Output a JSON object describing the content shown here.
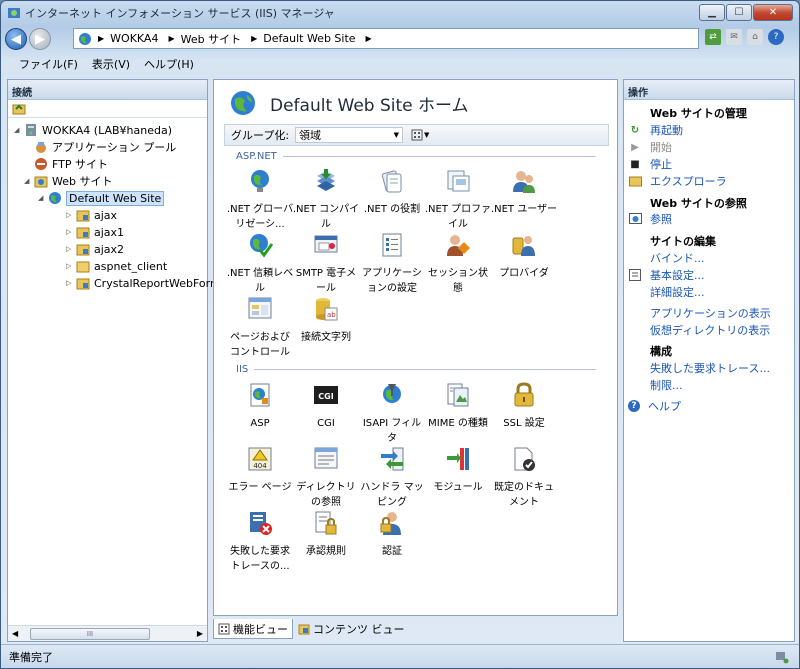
{
  "window": {
    "title": "インターネット インフォメーション サービス (IIS) マネージャ"
  },
  "address": {
    "segments": [
      "WOKKA4",
      "Web サイト",
      "Default Web Site"
    ]
  },
  "menu": {
    "file": "ファイル(F)",
    "view": "表示(V)",
    "help": "ヘルプ(H)"
  },
  "connections": {
    "title": "接続",
    "tree": [
      {
        "label": "WOKKA4 (LAB¥haneda)"
      },
      {
        "label": "アプリケーション プール"
      },
      {
        "label": "FTP サイト"
      },
      {
        "label": "Web サイト"
      },
      {
        "label": "Default Web Site"
      },
      {
        "label": "ajax"
      },
      {
        "label": "ajax1"
      },
      {
        "label": "ajax2"
      },
      {
        "label": "aspnet_client"
      },
      {
        "label": "CrystalReportWebForm"
      }
    ],
    "scroll_thumb": "III"
  },
  "center": {
    "title": "Default Web Site ホーム",
    "group_label": "グループ化:",
    "group_value": "領域",
    "sections": [
      "ASP.NET",
      "IIS"
    ],
    "aspnet_features": [
      {
        "label": ".NET グローバリゼーシ...",
        "icon": "globe-icon"
      },
      {
        "label": ".NET コンパイル",
        "icon": "compile-icon"
      },
      {
        "label": ".NET の役割",
        "icon": "roles-icon"
      },
      {
        "label": ".NET プロファイル",
        "icon": "profile-icon"
      },
      {
        "label": ".NET ユーザー",
        "icon": "users-icon"
      },
      {
        "label": ".NET 信頼レベル",
        "icon": "trust-icon"
      },
      {
        "label": "SMTP 電子メール",
        "icon": "smtp-icon"
      },
      {
        "label": "アプリケーションの設定",
        "icon": "app-settings-icon"
      },
      {
        "label": "セッション状態",
        "icon": "session-icon"
      },
      {
        "label": "プロバイダ",
        "icon": "providers-icon"
      },
      {
        "label": "ページおよびコントロール",
        "icon": "pages-icon"
      },
      {
        "label": "接続文字列",
        "icon": "connection-string-icon"
      }
    ],
    "iis_features": [
      {
        "label": "ASP",
        "icon": "asp-icon"
      },
      {
        "label": "CGI",
        "icon": "cgi-icon"
      },
      {
        "label": "ISAPI フィルタ",
        "icon": "isapi-icon"
      },
      {
        "label": "MIME の種類",
        "icon": "mime-icon"
      },
      {
        "label": "SSL 設定",
        "icon": "lock-icon"
      },
      {
        "label": "エラー ページ",
        "icon": "error-page-icon"
      },
      {
        "label": "ディレクトリの参照",
        "icon": "directory-icon"
      },
      {
        "label": "ハンドラ マッピング",
        "icon": "handler-icon"
      },
      {
        "label": "モジュール",
        "icon": "modules-icon"
      },
      {
        "label": "既定のドキュメント",
        "icon": "document-icon"
      },
      {
        "label": "失敗した要求トレースの...",
        "icon": "failed-trace-icon"
      },
      {
        "label": "承認規則",
        "icon": "authorization-icon"
      },
      {
        "label": "認証",
        "icon": "authentication-icon"
      }
    ],
    "error_page_badge": "404",
    "cgi_badge": "CGI"
  },
  "bottom_tabs": {
    "features": "機能ビュー",
    "content": "コンテンツ ビュー"
  },
  "actions": {
    "title": "操作",
    "manage_header": "Web サイトの管理",
    "restart": "再起動",
    "start": "開始",
    "stop": "停止",
    "explore": "エクスプローラ",
    "browse_header": "Web サイトの参照",
    "browse": "参照",
    "edit_header": "サイトの編集",
    "bindings": "バインド...",
    "basic_settings": "基本設定...",
    "advanced_settings": "詳細設定...",
    "view_apps": "アプリケーションの表示",
    "view_vdirs": "仮想ディレクトリの表示",
    "config_header": "構成",
    "failed_trace": "失敗した要求トレース...",
    "limits": "制限...",
    "help": "ヘルプ"
  },
  "status": {
    "text": "準備完了"
  }
}
